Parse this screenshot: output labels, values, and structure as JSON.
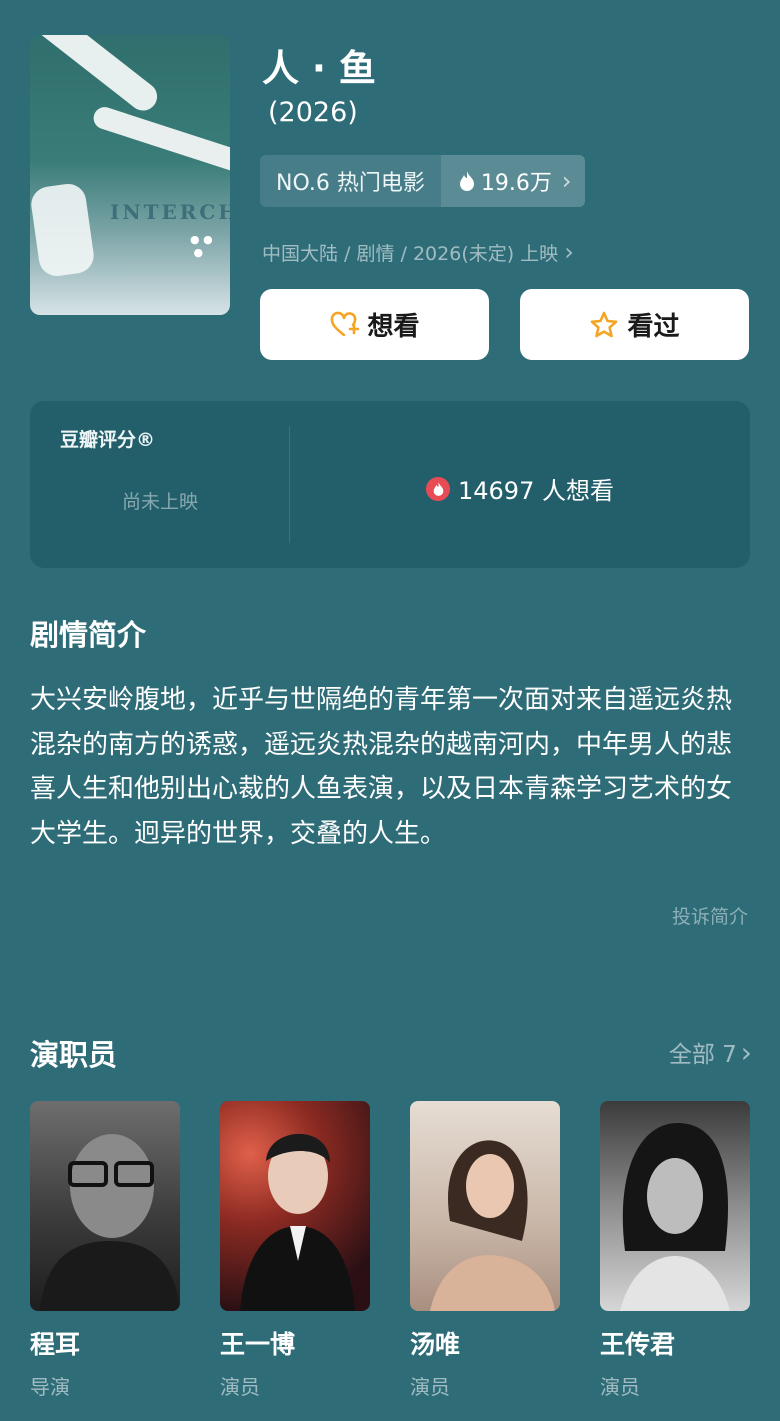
{
  "movie": {
    "title": "人 · 鱼",
    "year": "(2026)",
    "poster_text": "INTERCH",
    "rank_label": "NO.6 热门电影",
    "heat": "19.6万",
    "meta": "中国大陆 / 剧情 / 2026(未定) 上映"
  },
  "actions": {
    "want": "想看",
    "seen": "看过"
  },
  "rating": {
    "label": "豆瓣评分®",
    "status": "尚未上映",
    "want_count": "14697 人想看"
  },
  "synopsis": {
    "heading": "剧情简介",
    "text": "大兴安岭腹地，近乎与世隔绝的青年第一次面对来自遥远炎热混杂的南方的诱惑，遥远炎热混杂的越南河内，中年男人的悲喜人生和他别出心裁的人鱼表演，以及日本青森学习艺术的女大学生。迥异的世界，交叠的人生。",
    "report": "投诉简介"
  },
  "cast": {
    "heading": "演职员",
    "all_label": "全部 7",
    "members": [
      {
        "name": "程耳",
        "role": "导演"
      },
      {
        "name": "王一博",
        "role": "演员"
      },
      {
        "name": "汤唯",
        "role": "演员"
      },
      {
        "name": "王传君",
        "role": "演员"
      }
    ]
  },
  "colors": {
    "background": "#2e6c78",
    "card": "#225f6a",
    "accent_orange": "#f5a524",
    "fire_red": "#e94b55"
  },
  "icons": [
    "flame-icon",
    "chevron-right-icon",
    "heart-plus-icon",
    "star-icon"
  ]
}
